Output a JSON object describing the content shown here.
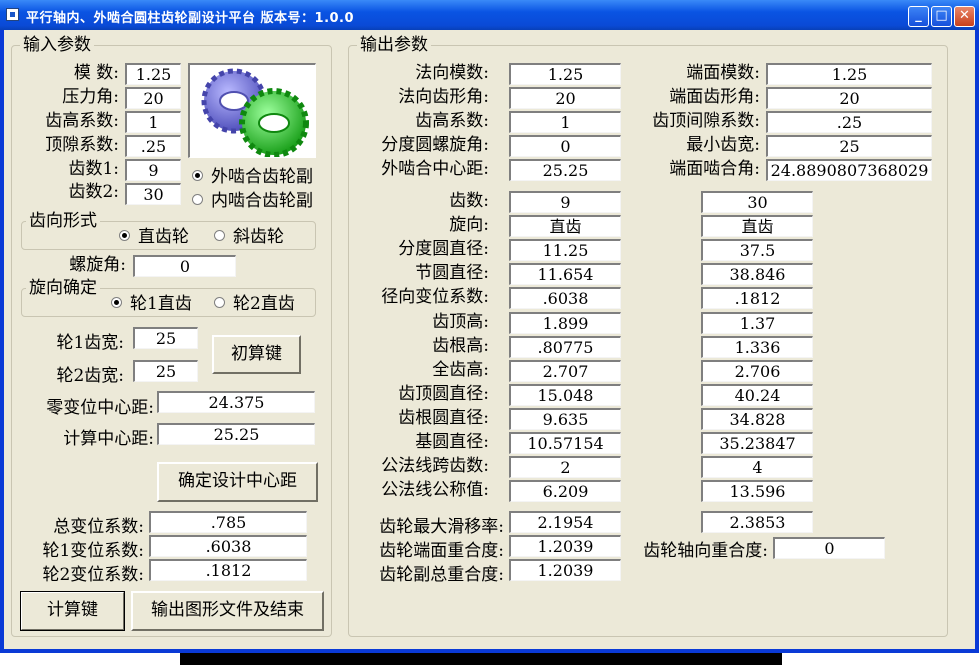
{
  "window": {
    "title": "平行轴内、外啮合圆柱齿轮副设计平台 版本号：1.0.0",
    "min_icon": "minimize-icon",
    "max_icon": "maximize-icon",
    "close_icon": "close-icon"
  },
  "input": {
    "legend": "输入参数",
    "module_label": "模 数:",
    "module": "1.25",
    "pressure_label": "压力角:",
    "pressure": "20",
    "addendum_label": "齿高系数:",
    "addendum": "1",
    "clearance_label": "顶隙系数:",
    "clearance": ".25",
    "z1_label": "齿数1:",
    "z1": "9",
    "z2_label": "齿数2:",
    "z2": "30",
    "mesh_external": "外啮合齿轮副",
    "mesh_internal": "内啮合齿轮副",
    "tooth_legend": "齿向形式",
    "spur": "直齿轮",
    "helical": "斜齿轮",
    "helix_label": "螺旋角:",
    "helix": "0",
    "dir_legend": "旋向确定",
    "dir1": "轮1直齿",
    "dir2": "轮2直齿",
    "b1_label": "轮1齿宽:",
    "b1": "25",
    "b2_label": "轮2齿宽:",
    "b2": "25",
    "initial_calc": "初算键",
    "zero_center_label": "零变位中心距:",
    "zero_center": "24.375",
    "calc_center_label": "计算中心距:",
    "calc_center": "25.25",
    "confirm_center": "确定设计中心距",
    "total_shift_label": "总变位系数:",
    "total_shift": ".785",
    "shift1_label": "轮1变位系数:",
    "shift1": ".6038",
    "shift2_label": "轮2变位系数:",
    "shift2": ".1812",
    "calc_button": "计算键",
    "export_button": "输出图形文件及结束"
  },
  "output": {
    "legend": "输出参数",
    "normal_module_label": "法向模数:",
    "normal_module": "1.25",
    "normal_angle_label": "法向齿形角:",
    "normal_angle": "20",
    "addendum_label": "齿高系数:",
    "addendum": "1",
    "helix_label": "分度圆螺旋角:",
    "helix": "0",
    "center_label": "外啮合中心距:",
    "center": "25.25",
    "transverse_module_label": "端面模数:",
    "transverse_module": "1.25",
    "transverse_angle_label": "端面齿形角:",
    "transverse_angle": "20",
    "clearance_label": "齿顶间隙系数:",
    "clearance": ".25",
    "min_width_label": "最小齿宽:",
    "min_width": "25",
    "working_angle_label": "端面啮合角:",
    "working_angle": "24.8890807368029",
    "rows": [
      {
        "label": "齿数:",
        "g1": "9",
        "g2": "30"
      },
      {
        "label": "旋向:",
        "g1": "直齿",
        "g2": "直齿"
      },
      {
        "label": "分度圆直径:",
        "g1": "11.25",
        "g2": "37.5"
      },
      {
        "label": "节圆直径:",
        "g1": "11.654",
        "g2": "38.846"
      },
      {
        "label": "径向变位系数:",
        "g1": ".6038",
        "g2": ".1812"
      },
      {
        "label": "齿顶高:",
        "g1": "1.899",
        "g2": "1.37"
      },
      {
        "label": "齿根高:",
        "g1": ".80775",
        "g2": "1.336"
      },
      {
        "label": "全齿高:",
        "g1": "2.707",
        "g2": "2.706"
      },
      {
        "label": "齿顶圆直径:",
        "g1": "15.048",
        "g2": "40.24"
      },
      {
        "label": "齿根圆直径:",
        "g1": "9.635",
        "g2": "34.828"
      },
      {
        "label": "基圆直径:",
        "g1": "10.57154",
        "g2": "35.23847"
      },
      {
        "label": "公法线跨齿数:",
        "g1": "2",
        "g2": "4"
      },
      {
        "label": "公法线公称值:",
        "g1": "6.209",
        "g2": "13.596"
      }
    ],
    "slide_label": "齿轮最大滑移率:",
    "slide1": "2.1954",
    "slide2": "2.3853",
    "transverse_contact_label": "齿轮端面重合度:",
    "transverse_contact": "1.2039",
    "axial_contact_label": "齿轮轴向重合度:",
    "axial_contact": "0",
    "total_contact_label": "齿轮副总重合度:",
    "total_contact": "1.2039"
  },
  "colors": {
    "gear_blue": "#7a7ae0",
    "gear_green": "#22cc22",
    "titlebar": "#0a54e3"
  }
}
